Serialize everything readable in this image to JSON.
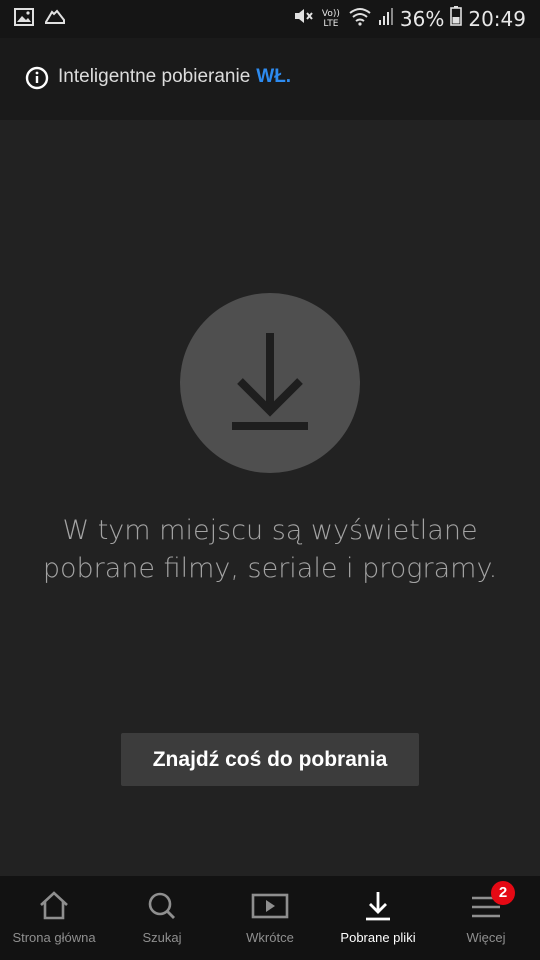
{
  "status_bar": {
    "battery": "36%",
    "time": "20:49",
    "volte": "Vo)) LTE"
  },
  "smart_download": {
    "label": "Inteligentne pobieranie",
    "state": "WŁ."
  },
  "empty_state": {
    "message_line1": "W tym miejscu są wyświetlane",
    "message_line2": "pobrane filmy, seriale i programy.",
    "button_label": "Znajdź coś do pobrania"
  },
  "bottom_nav": {
    "items": [
      {
        "label": "Strona główna",
        "icon": "home-icon"
      },
      {
        "label": "Szukaj",
        "icon": "search-icon"
      },
      {
        "label": "Wkrótce",
        "icon": "play-icon"
      },
      {
        "label": "Pobrane pliki",
        "icon": "download-icon",
        "active": true
      },
      {
        "label": "Więcej",
        "icon": "menu-icon",
        "badge": "2"
      }
    ]
  },
  "colors": {
    "accent": "#2d8bf0",
    "badge": "#e50914",
    "background": "#222222"
  }
}
